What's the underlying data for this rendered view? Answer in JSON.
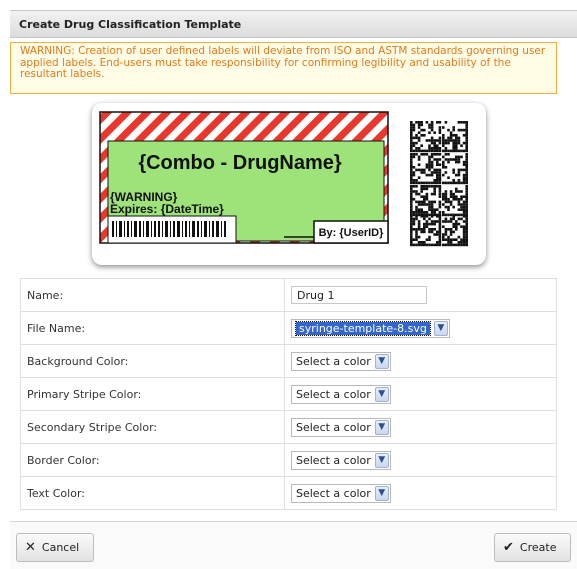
{
  "dialog": {
    "title": "Create Drug Classification Template",
    "warning": "WARNING: Creation of user defined labels will deviate from ISO and ASTM standards governing user applied labels. End-users must take responsibility for confirming legibility and usability of the resultant labels."
  },
  "preview": {
    "drug_name": "{Combo - DrugName}",
    "warning_text": "{WARNING}",
    "expires_text": "Expires: {DateTime}",
    "by_text": "By: {UserID}",
    "colors": {
      "background": "#9ee27a",
      "primary_stripe": "#e8382e",
      "secondary_stripe": "#ffffff",
      "border": "#111111",
      "text": "#111111"
    }
  },
  "form": {
    "rows": [
      {
        "label": "Name:",
        "type": "input",
        "value": "Drug 1"
      },
      {
        "label": "File Name:",
        "type": "select",
        "value": "syringe-template-8.svg",
        "selected": true
      },
      {
        "label": "Background Color:",
        "type": "select",
        "value": "Select a color"
      },
      {
        "label": "Primary Stripe Color:",
        "type": "select",
        "value": "Select a color"
      },
      {
        "label": "Secondary Stripe Color:",
        "type": "select",
        "value": "Select a color"
      },
      {
        "label": "Border Color:",
        "type": "select",
        "value": "Select a color"
      },
      {
        "label": "Text Color:",
        "type": "select",
        "value": "Select a color"
      }
    ]
  },
  "footer": {
    "cancel_label": "Cancel",
    "cancel_icon": "x-icon",
    "create_label": "Create",
    "create_icon": "check-icon"
  }
}
